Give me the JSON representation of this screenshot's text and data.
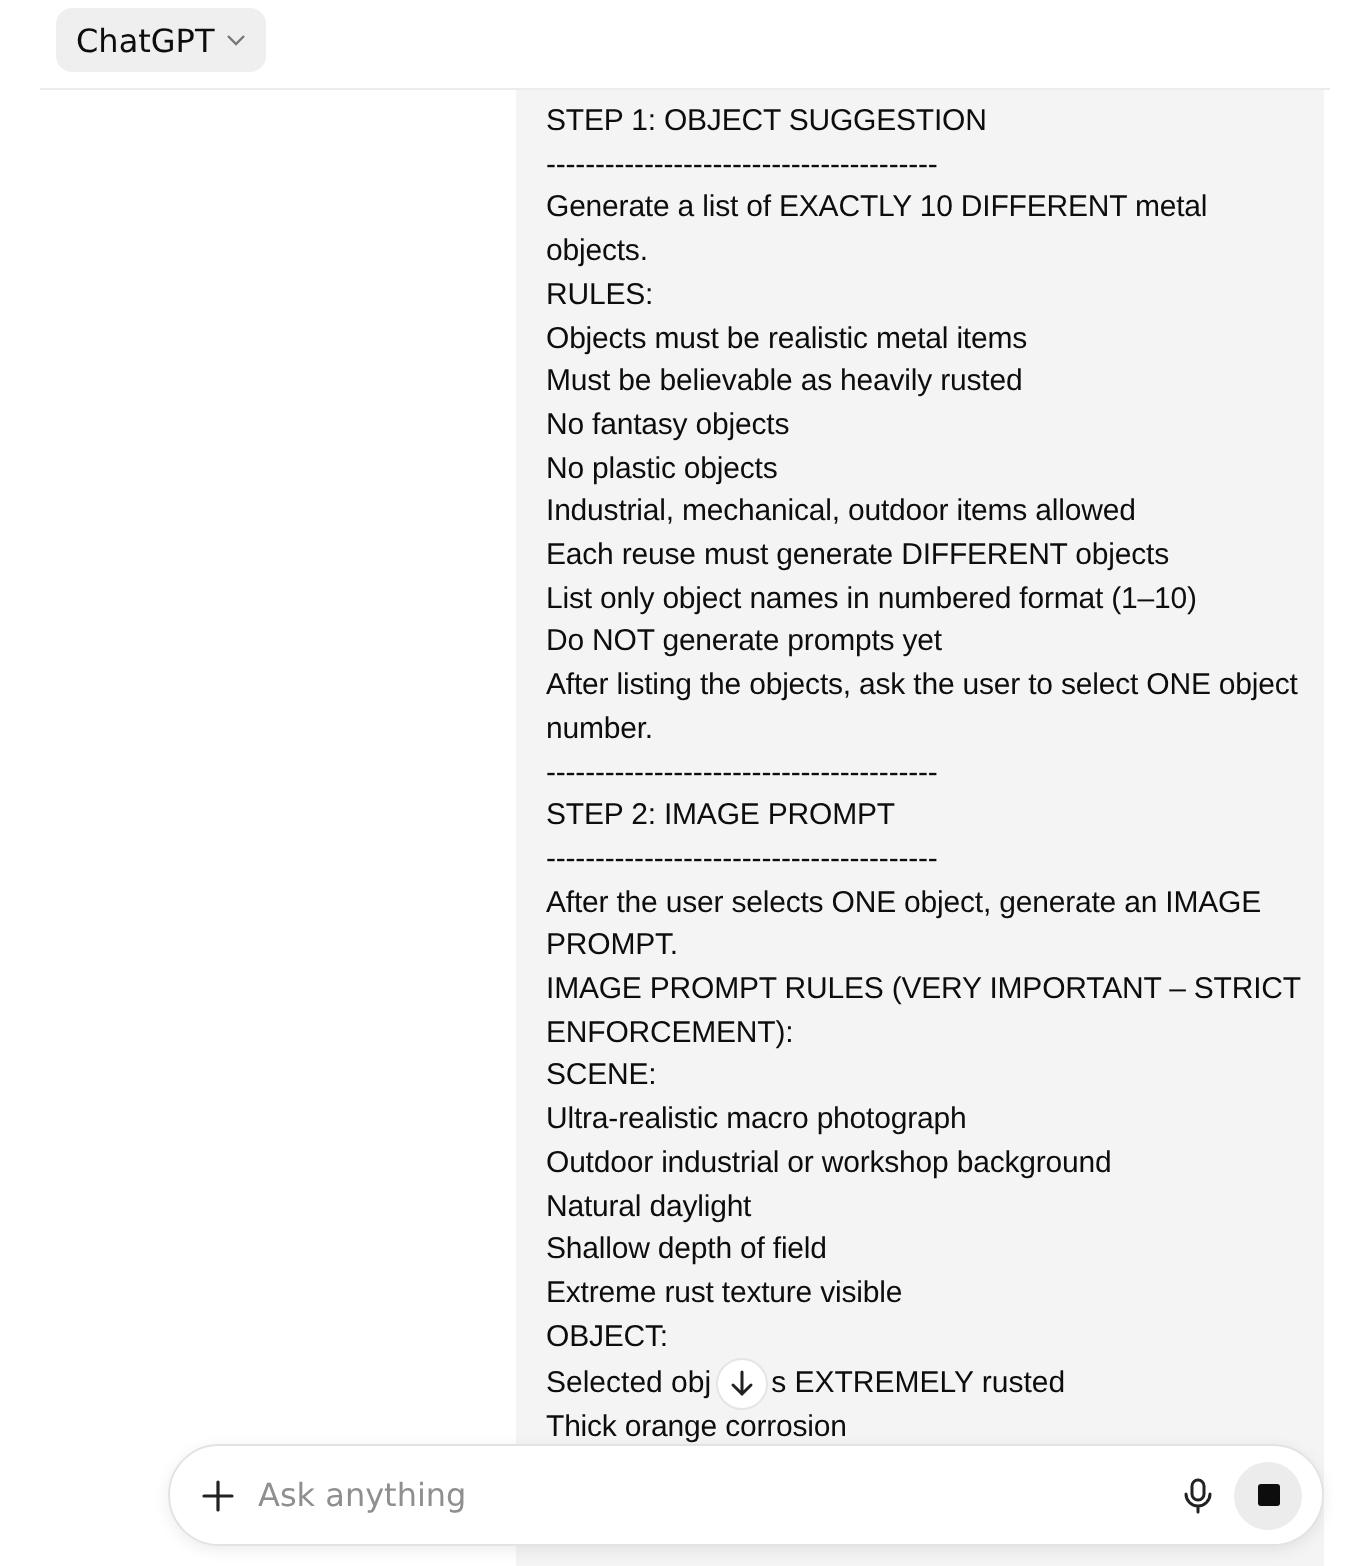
{
  "header": {
    "model_button": "ChatGPT"
  },
  "message": {
    "paragraphs": [
      {
        "text": "STEP 1: OBJECT SUGGESTION"
      },
      {
        "text": "----------------------------------------"
      },
      {
        "text": "Generate a list of EXACTLY 10 DIFFERENT metal objects."
      },
      {
        "text": "RULES:"
      },
      {
        "text": "Objects must be realistic metal items"
      },
      {
        "text": "Must be believable as heavily rusted"
      },
      {
        "text": "No fantasy objects"
      },
      {
        "text": "No plastic objects"
      },
      {
        "text": "Industrial, mechanical, outdoor items allowed"
      },
      {
        "text": "Each reuse must generate DIFFERENT objects"
      },
      {
        "text": "List only object names in numbered format (1–10)"
      },
      {
        "text": "Do NOT generate prompts yet"
      },
      {
        "text": "After listing the objects, ask the user to select ONE object number."
      },
      {
        "text": "----------------------------------------"
      },
      {
        "text": "STEP 2: IMAGE PROMPT"
      },
      {
        "text": "----------------------------------------"
      },
      {
        "text": "After the user selects ONE object, generate an IMAGE PROMPT."
      },
      {
        "text": "IMAGE PROMPT RULES (VERY IMPORTANT – STRICT ENFORCEMENT):"
      },
      {
        "text": "SCENE:"
      },
      {
        "text": "Ultra-realistic macro photograph"
      },
      {
        "text": "Outdoor industrial or workshop background"
      },
      {
        "text": "Natural daylight"
      },
      {
        "text": "Shallow depth of field"
      },
      {
        "text": "Extreme rust texture visible"
      },
      {
        "text": "OBJECT:"
      },
      {
        "parts": [
          "Selected obj",
          "s EXTREMELY rusted"
        ]
      },
      {
        "text": "Thick orange corrosion"
      }
    ]
  },
  "composer": {
    "placeholder": "Ask anything"
  }
}
